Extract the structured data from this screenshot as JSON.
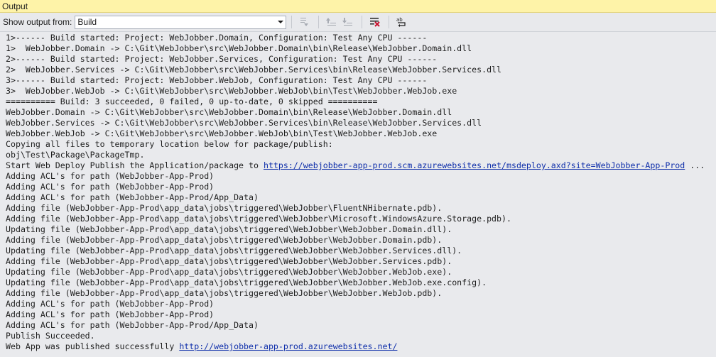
{
  "panel": {
    "title": "Output"
  },
  "toolbar": {
    "show_output_label": "Show output from:",
    "source_selected": "Build",
    "buttons": [
      {
        "icon": "go-to-previous-message-icon"
      },
      {
        "icon": "find-previous-icon"
      },
      {
        "icon": "find-next-icon"
      },
      {
        "icon": "clear-all-icon"
      },
      {
        "icon": "word-wrap-icon"
      }
    ]
  },
  "output": {
    "lines": [
      {
        "text": "1>------ Build started: Project: WebJobber.Domain, Configuration: Test Any CPU ------"
      },
      {
        "text": "1>  WebJobber.Domain -> C:\\Git\\WebJobber\\src\\WebJobber.Domain\\bin\\Release\\WebJobber.Domain.dll"
      },
      {
        "text": "2>------ Build started: Project: WebJobber.Services, Configuration: Test Any CPU ------"
      },
      {
        "text": "2>  WebJobber.Services -> C:\\Git\\WebJobber\\src\\WebJobber.Services\\bin\\Release\\WebJobber.Services.dll"
      },
      {
        "text": "3>------ Build started: Project: WebJobber.WebJob, Configuration: Test Any CPU ------"
      },
      {
        "text": "3>  WebJobber.WebJob -> C:\\Git\\WebJobber\\src\\WebJobber.WebJob\\bin\\Test\\WebJobber.WebJob.exe"
      },
      {
        "text": "========== Build: 3 succeeded, 0 failed, 0 up-to-date, 0 skipped =========="
      },
      {
        "text": "WebJobber.Domain -> C:\\Git\\WebJobber\\src\\WebJobber.Domain\\bin\\Release\\WebJobber.Domain.dll"
      },
      {
        "text": "WebJobber.Services -> C:\\Git\\WebJobber\\src\\WebJobber.Services\\bin\\Release\\WebJobber.Services.dll"
      },
      {
        "text": "WebJobber.WebJob -> C:\\Git\\WebJobber\\src\\WebJobber.WebJob\\bin\\Test\\WebJobber.WebJob.exe"
      },
      {
        "text": "Copying all files to temporary location below for package/publish:"
      },
      {
        "text": "obj\\Test\\Package\\PackageTmp."
      },
      {
        "text": "Start Web Deploy Publish the Application/package to ",
        "link": "https://webjobber-app-prod.scm.azurewebsites.net/msdeploy.axd?site=WebJobber-App-Prod",
        "suffix": " ..."
      },
      {
        "text": "Adding ACL's for path (WebJobber-App-Prod)"
      },
      {
        "text": "Adding ACL's for path (WebJobber-App-Prod)"
      },
      {
        "text": "Adding ACL's for path (WebJobber-App-Prod/App_Data)"
      },
      {
        "text": "Adding file (WebJobber-App-Prod\\app_data\\jobs\\triggered\\WebJobber\\FluentNHibernate.pdb)."
      },
      {
        "text": "Adding file (WebJobber-App-Prod\\app_data\\jobs\\triggered\\WebJobber\\Microsoft.WindowsAzure.Storage.pdb)."
      },
      {
        "text": "Updating file (WebJobber-App-Prod\\app_data\\jobs\\triggered\\WebJobber\\WebJobber.Domain.dll)."
      },
      {
        "text": "Adding file (WebJobber-App-Prod\\app_data\\jobs\\triggered\\WebJobber\\WebJobber.Domain.pdb)."
      },
      {
        "text": "Updating file (WebJobber-App-Prod\\app_data\\jobs\\triggered\\WebJobber\\WebJobber.Services.dll)."
      },
      {
        "text": "Adding file (WebJobber-App-Prod\\app_data\\jobs\\triggered\\WebJobber\\WebJobber.Services.pdb)."
      },
      {
        "text": "Updating file (WebJobber-App-Prod\\app_data\\jobs\\triggered\\WebJobber\\WebJobber.WebJob.exe)."
      },
      {
        "text": "Updating file (WebJobber-App-Prod\\app_data\\jobs\\triggered\\WebJobber\\WebJobber.WebJob.exe.config)."
      },
      {
        "text": "Adding file (WebJobber-App-Prod\\app_data\\jobs\\triggered\\WebJobber\\WebJobber.WebJob.pdb)."
      },
      {
        "text": "Adding ACL's for path (WebJobber-App-Prod)"
      },
      {
        "text": "Adding ACL's for path (WebJobber-App-Prod)"
      },
      {
        "text": "Adding ACL's for path (WebJobber-App-Prod/App_Data)"
      },
      {
        "text": "Publish Succeeded."
      },
      {
        "text": "Web App was published successfully ",
        "link": "http://webjobber-app-prod.azurewebsites.net/"
      }
    ]
  },
  "colors": {
    "title_bar": "#fef3a8",
    "background": "#e9eaed",
    "text": "#1e1e1e",
    "link": "#0f2faa"
  }
}
